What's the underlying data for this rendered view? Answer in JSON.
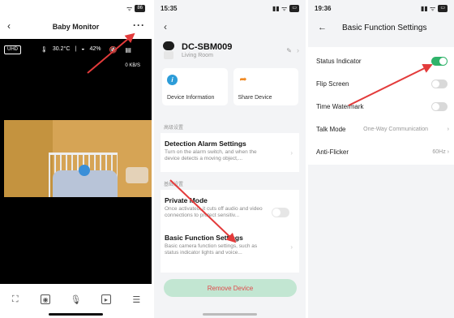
{
  "phone1": {
    "title": "Baby Monitor",
    "back_icon": "chevron-left-icon",
    "more_icon": "more-dots-icon",
    "status_icons": "wifi-icon battery-icon",
    "battery": "86",
    "quality_badge": "UHD",
    "temperature": "30.2°C",
    "humidity": "42%",
    "bitrate": "0 KB/S",
    "controls": [
      "fullscreen-icon",
      "snapshot-icon",
      "microphone-icon",
      "record-icon",
      "menu-icon"
    ]
  },
  "phone2": {
    "time": "15:35",
    "device_name": "DC-SBM009",
    "device_room": "Living Room",
    "tiles": [
      {
        "label": "Device Information",
        "icon": "info-icon",
        "color": "#2c9cd8"
      },
      {
        "label": "Share Device",
        "icon": "share-arrow-icon",
        "color": "#f08a24"
      }
    ],
    "section1_label": "高级设置",
    "detection": {
      "title": "Detection Alarm Settings",
      "desc": "Turn on the alarm switch, and when the device detects a moving object,..."
    },
    "section2_label": "基础设置",
    "private_mode": {
      "title": "Private Mode",
      "desc": "Once activated, it cuts off audio and video connections to protect sensitiv...",
      "enabled": false
    },
    "basic_function": {
      "title": "Basic Function Settings",
      "desc": "Basic camera function settings, such as status indicator lights and voice..."
    },
    "remove_label": "Remove Device",
    "remove_color": "#e04a4a"
  },
  "phone3": {
    "time": "19:36",
    "title": "Basic Function Settings",
    "rows": [
      {
        "label": "Status Indicator",
        "type": "toggle",
        "enabled": true
      },
      {
        "label": "Flip Screen",
        "type": "toggle",
        "enabled": false
      },
      {
        "label": "Time Watermark",
        "type": "toggle",
        "enabled": false
      },
      {
        "label": "Talk Mode",
        "type": "value",
        "value": "One-Way Communication"
      },
      {
        "label": "Anti-Flicker",
        "type": "value",
        "value": "60Hz"
      }
    ],
    "accent": "#2fb36a"
  },
  "annotation_color": "#e33b3b"
}
